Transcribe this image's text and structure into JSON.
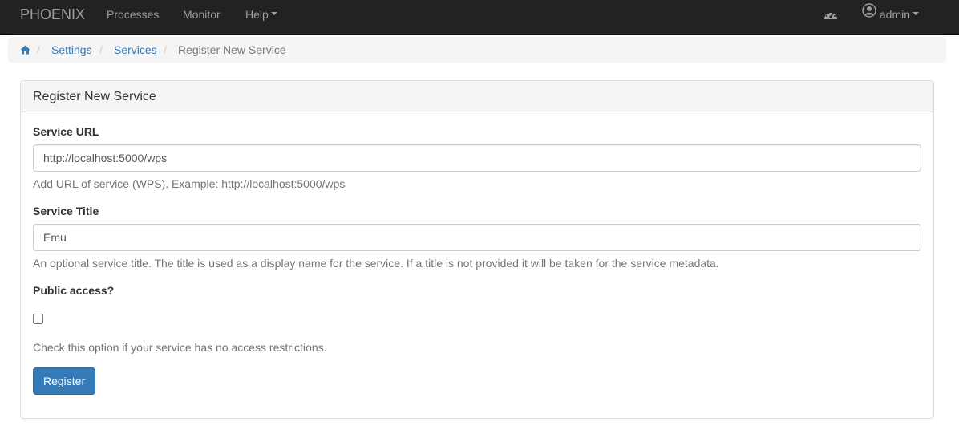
{
  "navbar": {
    "brand": "PHOENIX",
    "links": [
      {
        "label": "Processes"
      },
      {
        "label": "Monitor"
      },
      {
        "label": "Help"
      }
    ],
    "dashboard_icon": "dashboard-icon",
    "user_icon": "user-circle-icon",
    "user_label": "admin"
  },
  "breadcrumb": {
    "home_icon": "home-icon",
    "items": [
      "Settings",
      "Services"
    ],
    "active": "Register New Service",
    "separator": "/"
  },
  "panel": {
    "title": "Register New Service",
    "service_url": {
      "label": "Service URL",
      "value": "http://localhost:5000/wps",
      "help": "Add URL of service (WPS). Example: http://localhost:5000/wps"
    },
    "service_title": {
      "label": "Service Title",
      "value": "Emu",
      "help": "An optional service title. The title is used as a display name for the service. If a title is not provided it will be taken for the service metadata."
    },
    "public_access": {
      "label": "Public access?",
      "checked": false,
      "help": "Check this option if your service has no access restrictions."
    },
    "submit_label": "Register"
  },
  "colors": {
    "navbar_bg": "#222222",
    "link": "#337ab7",
    "primary_button": "#337ab7"
  }
}
